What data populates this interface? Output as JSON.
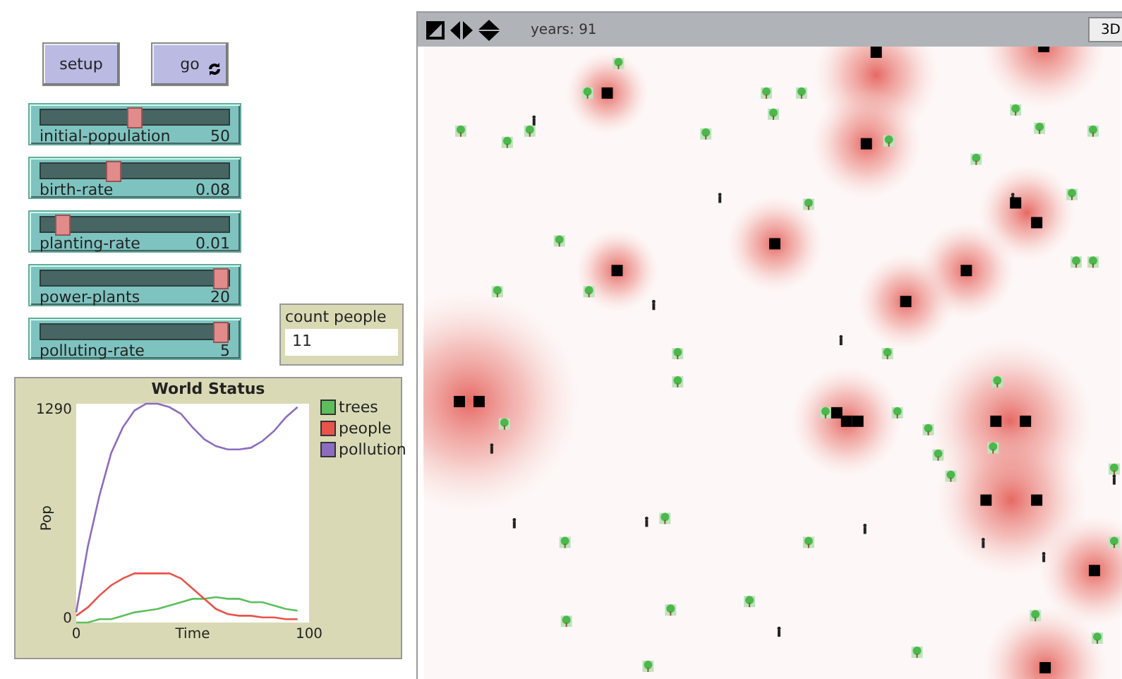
{
  "buttons": [
    {
      "label": "setup",
      "forever": false
    },
    {
      "label": "go",
      "forever": true
    }
  ],
  "sliders": [
    {
      "name": "initial-population",
      "value": "50",
      "level": 0.5
    },
    {
      "name": "birth-rate",
      "value": "0.08",
      "level": 0.38
    },
    {
      "name": "planting-rate",
      "value": "0.01",
      "level": 0.08
    },
    {
      "name": "power-plants",
      "value": "20",
      "level": 1
    },
    {
      "name": "polluting-rate",
      "value": "5",
      "level": 1
    }
  ],
  "monitor": {
    "label": "count people",
    "value": "11"
  },
  "plot": {
    "chart_data": {
      "type": "line",
      "title": "World Status",
      "xlabel": "Time",
      "ylabel": "Pop",
      "x": [
        0,
        5,
        10,
        15,
        20,
        25,
        30,
        35,
        40,
        45,
        50,
        55,
        60,
        65,
        70,
        75,
        80,
        85,
        90,
        95
      ],
      "xlim": [
        0,
        100
      ],
      "ylim": [
        0,
        1290
      ],
      "xticks": [
        0,
        100
      ],
      "yticks": [
        0,
        1290
      ],
      "series": [
        {
          "name": "trees",
          "color": "#5cbf5c",
          "values": [
            0,
            0,
            20,
            20,
            40,
            60,
            70,
            80,
            100,
            120,
            140,
            140,
            150,
            140,
            140,
            120,
            120,
            100,
            80,
            70
          ]
        },
        {
          "name": "people",
          "color": "#e8534a",
          "values": [
            40,
            90,
            160,
            220,
            260,
            290,
            290,
            290,
            290,
            260,
            200,
            140,
            80,
            50,
            40,
            40,
            30,
            30,
            20,
            20
          ]
        },
        {
          "name": "pollution",
          "color": "#8c6cbf",
          "values": [
            60,
            450,
            750,
            1000,
            1150,
            1250,
            1290,
            1290,
            1270,
            1230,
            1150,
            1080,
            1040,
            1020,
            1020,
            1030,
            1070,
            1130,
            1210,
            1270
          ]
        }
      ]
    }
  },
  "view": {
    "ticks_label": "years: 91",
    "button_3d": "3D"
  }
}
